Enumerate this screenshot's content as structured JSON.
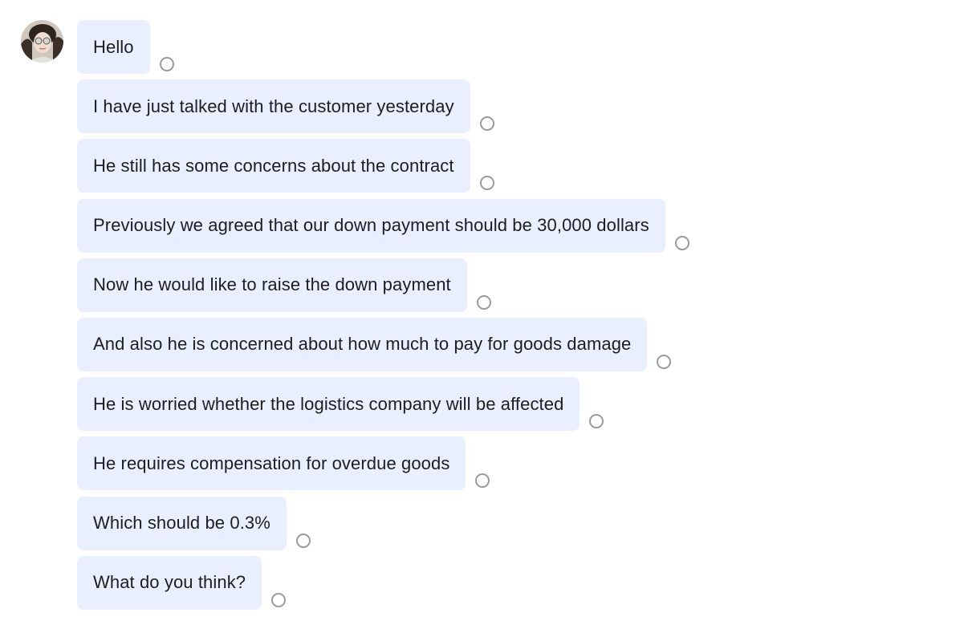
{
  "chat": {
    "avatar_icon": "user-avatar-photo",
    "bubble_color": "#e9efff",
    "status_icon": "read-receipt-circle-icon",
    "messages": [
      {
        "text": "Hello"
      },
      {
        "text": "I have just talked with the customer yesterday"
      },
      {
        "text": "He still has some concerns about the contract"
      },
      {
        "text": "Previously we agreed that our down payment should be 30,000 dollars"
      },
      {
        "text": "Now he would like to raise the down payment"
      },
      {
        "text": "And also he is concerned about how much to pay for goods damage"
      },
      {
        "text": "He is worried whether the logistics company will be affected"
      },
      {
        "text": "He requires compensation for overdue goods"
      },
      {
        "text": "Which should be 0.3%"
      },
      {
        "text": "What do you think?"
      }
    ]
  }
}
